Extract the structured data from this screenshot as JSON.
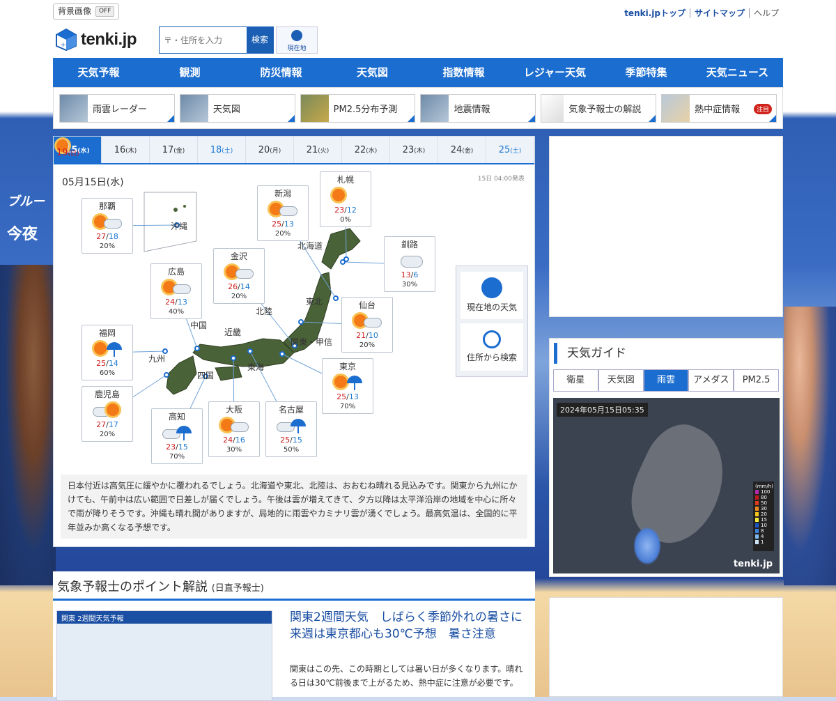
{
  "topbar": {
    "bg_label": "背景画像",
    "bg_toggle": "OFF",
    "links": [
      "tenki.jpトップ",
      "サイトマップ",
      "ヘルプ"
    ]
  },
  "header": {
    "logo": "tenki.jp",
    "search_placeholder": "〒・住所を入力",
    "search_button": "検索",
    "location_button": "現在地"
  },
  "nav": [
    "天気予報",
    "観測",
    "防災情報",
    "天気図",
    "指数情報",
    "レジャー天気",
    "季節特集",
    "天気ニュース"
  ],
  "shortcuts": [
    {
      "label": "雨雲レーダー"
    },
    {
      "label": "天気図"
    },
    {
      "label": "PM2.5分布予測"
    },
    {
      "label": "地震情報"
    },
    {
      "label": "気象予報士の解説"
    },
    {
      "label": "熱中症情報",
      "badge": "注目"
    }
  ],
  "days": [
    {
      "num": "15",
      "dow": "水",
      "type": "active"
    },
    {
      "num": "16",
      "dow": "木",
      "type": ""
    },
    {
      "num": "17",
      "dow": "金",
      "type": ""
    },
    {
      "num": "18",
      "dow": "土",
      "type": "sat"
    },
    {
      "num": "19",
      "dow": "日",
      "type": "sun"
    },
    {
      "num": "20",
      "dow": "月",
      "type": ""
    },
    {
      "num": "21",
      "dow": "火",
      "type": ""
    },
    {
      "num": "22",
      "dow": "水",
      "type": ""
    },
    {
      "num": "23",
      "dow": "木",
      "type": ""
    },
    {
      "num": "24",
      "dow": "金",
      "type": ""
    },
    {
      "num": "25",
      "dow": "土",
      "type": "sat"
    }
  ],
  "forecast": {
    "date": "05月15日(水)",
    "issued": "15日 04:00発表",
    "cities": [
      {
        "name": "那覇",
        "weather": "sun-cloud",
        "hi": "27",
        "lo": "18",
        "pop": "20%"
      },
      {
        "name": "新潟",
        "weather": "sun-cloud",
        "hi": "25",
        "lo": "13",
        "pop": "20%"
      },
      {
        "name": "札幌",
        "weather": "sun",
        "hi": "23",
        "lo": "12",
        "pop": "0%"
      },
      {
        "name": "釧路",
        "weather": "cloud",
        "hi": "13",
        "lo": "6",
        "pop": "30%"
      },
      {
        "name": "金沢",
        "weather": "sun-cloud",
        "hi": "26",
        "lo": "14",
        "pop": "20%"
      },
      {
        "name": "広島",
        "weather": "sun-cloud",
        "hi": "24",
        "lo": "13",
        "pop": "40%"
      },
      {
        "name": "仙台",
        "weather": "sun-cloud",
        "hi": "21",
        "lo": "10",
        "pop": "20%"
      },
      {
        "name": "福岡",
        "weather": "sun-rain",
        "hi": "25",
        "lo": "14",
        "pop": "60%"
      },
      {
        "name": "東京",
        "weather": "sun-rain",
        "hi": "25",
        "lo": "13",
        "pop": "70%"
      },
      {
        "name": "鹿児島",
        "weather": "cloud-sun",
        "hi": "27",
        "lo": "17",
        "pop": "20%"
      },
      {
        "name": "高知",
        "weather": "cloud-rain",
        "hi": "23",
        "lo": "15",
        "pop": "70%"
      },
      {
        "name": "大阪",
        "weather": "sun-cloud",
        "hi": "24",
        "lo": "16",
        "pop": "30%"
      },
      {
        "name": "名古屋",
        "weather": "cloud-rain",
        "hi": "25",
        "lo": "15",
        "pop": "50%"
      }
    ],
    "regions": [
      "沖縄",
      "北海道",
      "東北",
      "北陸",
      "中国",
      "近畿",
      "関東・甲信",
      "九州",
      "四国",
      "東海"
    ],
    "side_buttons": [
      "現在地の天気",
      "住所から検索"
    ],
    "description": "日本付近は高気圧に緩やかに覆われるでしょう。北海道や東北、北陸は、おおむね晴れる見込みです。関東から九州にかけても、午前中は広い範囲で日差しが届くでしょう。午後は雲が増えてきて、夕方以降は太平洋沿岸の地域を中心に所々で雨が降りそうです。沖縄も晴れ間がありますが、局地的に雨雲やカミナリ雲が湧くでしょう。最高気温は、全国的に平年並みか高くなる予想です。"
  },
  "point": {
    "heading": "気象予報士のポイント解説",
    "sub": "(日直予報士)",
    "image_caption": "関東 2週間天気予報",
    "title": "関東2週間天気　しばらく季節外れの暑さに　来週は東京都心も30℃予想　暑さ注意",
    "body": "関東はこの先、この時期としては暑い日が多くなります。晴れる日は30℃前後まで上がるため、熱中症に注意が必要です。"
  },
  "guide": {
    "title": "天気ガイド",
    "tabs": [
      "衛星",
      "天気図",
      "雨雲",
      "アメダス",
      "PM2.5"
    ],
    "active_tab": 2,
    "timestamp": "2024年05月15日05:35",
    "legend_title": "(mm/h)",
    "legend": [
      "100",
      "80",
      "50",
      "30",
      "20",
      "15",
      "10",
      "8",
      "4",
      "1"
    ],
    "watermark": "tenki.jp"
  },
  "banner": {
    "brand": "ブルー",
    "text": "今夜"
  }
}
